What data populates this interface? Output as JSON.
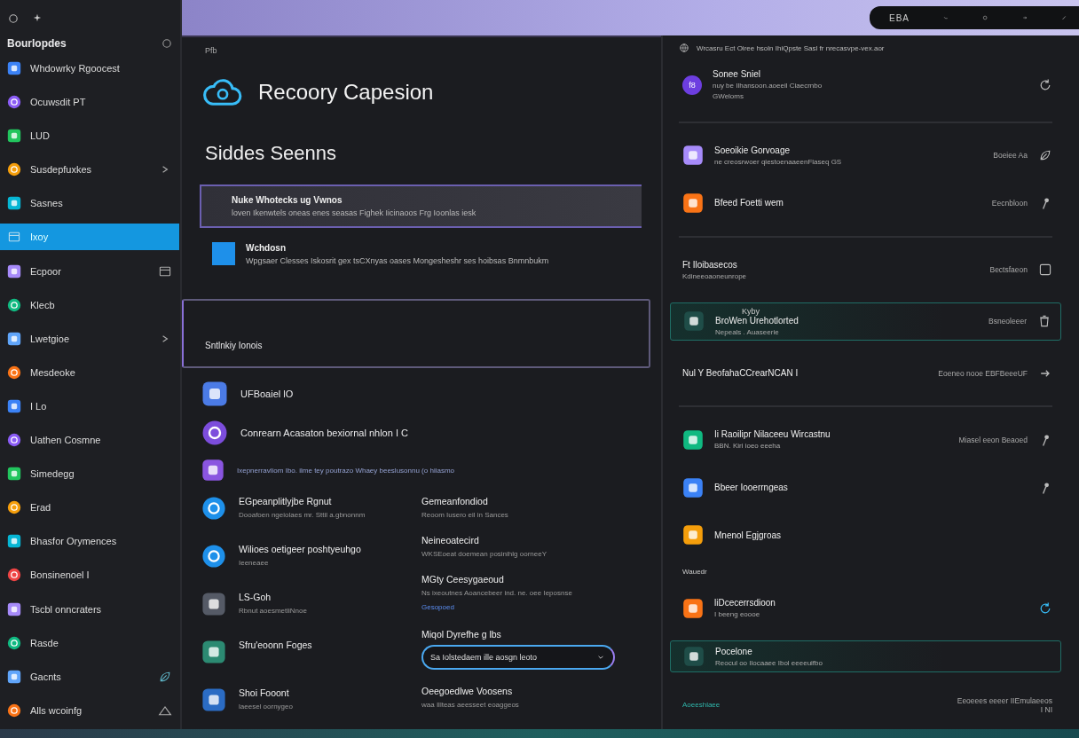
{
  "top_bar": {
    "label": "EBA"
  },
  "sidebar": {
    "header": "Bourlopdes",
    "items": [
      {
        "label": "Whdowrky Rgoocest",
        "selected": false
      },
      {
        "label": "Ocuwsdit PT",
        "selected": false
      },
      {
        "label": "LUD",
        "selected": false
      },
      {
        "label": "Susdepfuxkes",
        "selected": false,
        "trailing": {
          "kind": "chevron"
        }
      },
      {
        "label": "Sasnes",
        "selected": false
      },
      {
        "label": "Ixoy",
        "selected": true
      },
      {
        "label": "Ecpoor",
        "selected": false,
        "trailing": {
          "kind": "panel"
        }
      },
      {
        "label": "Klecb",
        "selected": false
      },
      {
        "label": "Lwetgioe",
        "selected": false,
        "trailing": {
          "kind": "chevron"
        }
      },
      {
        "label": "Mesdeoke",
        "selected": false
      },
      {
        "label": "I Lo",
        "selected": false
      },
      {
        "label": "Uathen Cosmne",
        "selected": false
      },
      {
        "label": "Simedegg",
        "selected": false
      },
      {
        "label": "Erad",
        "selected": false
      },
      {
        "label": "Bhasfor Orymences",
        "selected": false
      },
      {
        "label": "Bonsinenoel I",
        "selected": false
      },
      {
        "label": "Tscbl onncraters",
        "selected": false
      },
      {
        "label": "Rasde",
        "selected": false
      },
      {
        "label": "Gacnts",
        "selected": false,
        "trailing": {
          "kind": "leaf"
        }
      },
      {
        "label": "Alls wcoinfg",
        "selected": false,
        "trailing": {
          "kind": "triangle"
        }
      }
    ]
  },
  "main": {
    "breadcrumb": "Pfb",
    "title": "Recoory Capesion",
    "section_title": "Siddes Seenns",
    "options": [
      {
        "title": "Nuke Whotecks ug Vwnos",
        "description": "loven Ikenwtels oneas enes seasas Fighek Iicinaoos Frg Ioonlas iesk",
        "selected": true
      },
      {
        "title": "Wchdosn",
        "description": "Wpgsaer Clesses Iskosrit gex tsCXnyas oases Mongesheshr ses hoibsas Bnmnbukm",
        "selected": false
      }
    ],
    "box_label": "Sntlnkiy Ionois",
    "features": [
      {
        "kind": "title",
        "text": "UFBoaiel lO"
      },
      {
        "kind": "text",
        "text": "Conrearn Acasaton bexiornal nhlon I C"
      },
      {
        "kind": "note",
        "text": "Ixepnerravliom Ibo. ilme tey poutrazo Whaey beeslusonnu (o hiiasmo"
      }
    ],
    "left_items": [
      {
        "title": "EGpeanplitlyjbe Rgnut",
        "subtitle": "Dooafoen ngeiolaes mr. Sttil a.gbnonnm"
      },
      {
        "title": "Wilioes oetigeer poshtyeuhgo",
        "subtitle": "Ieeneaee"
      },
      {
        "title": "LS-Goh",
        "subtitle": "Rbnut aoesmetliNnoe"
      },
      {
        "title": "Sfru'eoonn Foges"
      },
      {
        "title": "Shoi Fooont",
        "subtitle": "laeesel oornygeo"
      }
    ],
    "right_items": [
      {
        "kind": "setting",
        "title": "Gemeanfondiod",
        "subtitle": "Reoom Iusero eil in Sances"
      },
      {
        "kind": "setting",
        "title": "Neineoatecird",
        "subtitle": "WKSEoeat doemean posinihlg oorneeY"
      },
      {
        "kind": "setting",
        "title": "MGty Ceesygaeoud",
        "subtitle": "Ns ixeoutnes Aoancebeer ind. ne. oee Ieposnse",
        "link": "Gesopoed"
      },
      {
        "kind": "field",
        "title": "Miqol Dyrefhe g lbs",
        "value": "Sa Iolstedaem ille aosgn leoto"
      },
      {
        "kind": "setting",
        "title": "Oeegoedlwe Voosens",
        "subtitle": "waa Illteas aeesseet eoaggeos"
      }
    ]
  },
  "panel": {
    "path": "Wrcasru Ect Oiree hsoln IhiQpste Sasl fr nrecasvpe-vex.aor",
    "rows": [
      {
        "kind": "item",
        "badge": "f8",
        "title": "Sonee Sniel",
        "subtitle": "nuy be Ilhansoon.aoeeil Ciaecrnbo",
        "detail": "GWeloms"
      },
      {
        "kind": "divider"
      },
      {
        "kind": "item",
        "title": "Soeoikie Gorvoage",
        "subtitle": "ne creosrwoer qiestoenaaeenFlaseq GS",
        "meta": "Boeiee Aa"
      },
      {
        "kind": "item",
        "title": "Bfeed Foetti wem",
        "meta": "Eecnbloon"
      },
      {
        "kind": "divider"
      },
      {
        "kind": "plain",
        "title": "Ft Iloibasecos",
        "subtitle": "Kdineeoaoneunrope",
        "meta": "Bectsfaeon"
      },
      {
        "kind": "highlight",
        "overline": "Kyby",
        "title": "BroWen Urehotlorted",
        "detail": "Nepeals . Auaseerie",
        "meta": "Bsneoleeer"
      },
      {
        "kind": "plain",
        "title": "Nul Y BeofahaCCrearNCAN I",
        "meta": "Eoeneo nooe EBFBeeeUF"
      },
      {
        "kind": "divider"
      },
      {
        "kind": "item",
        "title": "Ii Raoilipr Nilaceeu Wircastnu",
        "subtitle": "BBN. Kiri ioeo eeeha",
        "meta": "Miasel eeon Beaoed"
      },
      {
        "kind": "item",
        "title": "Bbeer Iooerrngeas"
      },
      {
        "kind": "item",
        "title": "Mnenol Egjgroas"
      },
      {
        "kind": "section",
        "title": "Wauedr"
      },
      {
        "kind": "item",
        "title": "liDcecerrsdioon",
        "subtitle": "I beeng eoooe"
      },
      {
        "kind": "highlight",
        "title": "Pocelone",
        "subtitle": "Reocul oo Ilocaaee Ibol eeeeuifbo"
      },
      {
        "kind": "footer",
        "title": "Aoeeshlaee",
        "meta": "Eeoeees eeeer IIEmulaeeos I NI"
      }
    ]
  }
}
